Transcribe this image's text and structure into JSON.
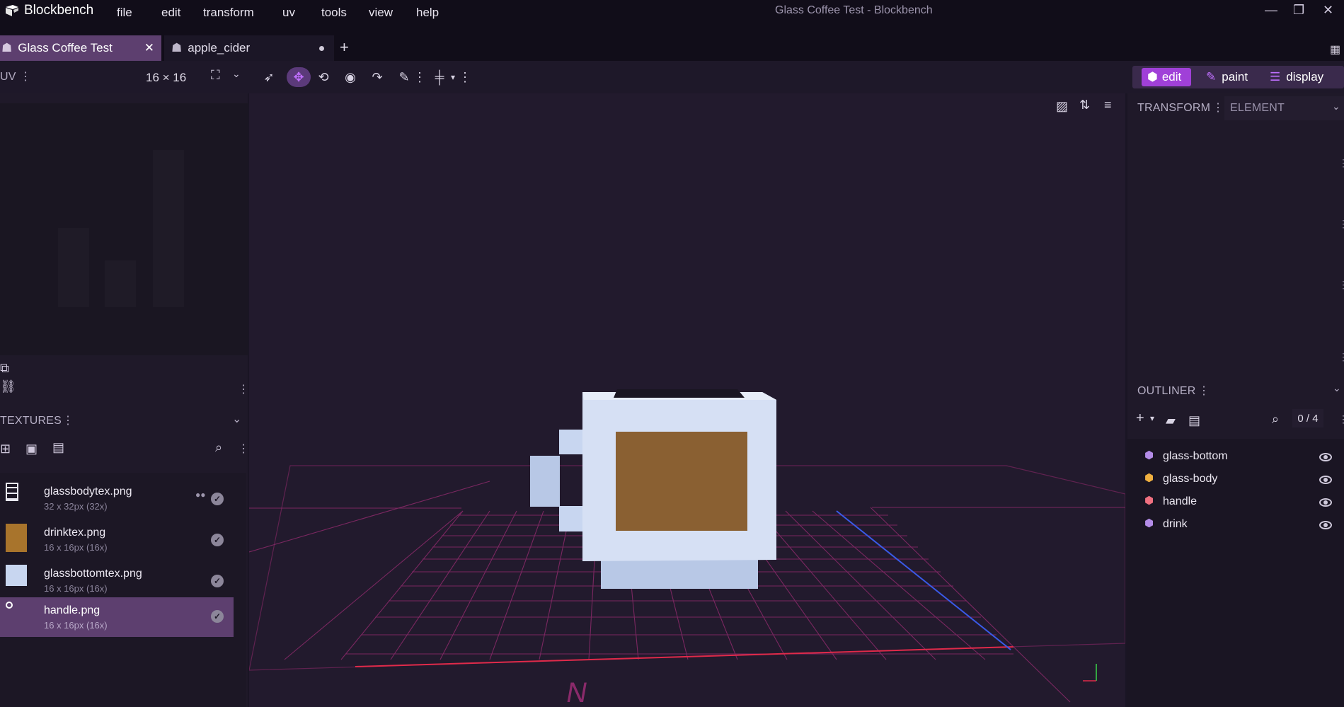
{
  "app": {
    "name": "Blockbench",
    "window_title": "Glass Coffee Test - Blockbench"
  },
  "menu": [
    "file",
    "edit",
    "transform",
    "uv",
    "tools",
    "view",
    "help"
  ],
  "tabs": [
    {
      "label": "Glass Coffee Test",
      "active": true
    },
    {
      "label": "apple_cider",
      "active": false
    }
  ],
  "uv_panel": {
    "title": "UV",
    "size": "16 × 16"
  },
  "textures": {
    "title": "TEXTURES",
    "items": [
      {
        "name": "glassbodytex.png",
        "size": "32 x 32px (32x)"
      },
      {
        "name": "drinktex.png",
        "size": "16 x 16px (16x)"
      },
      {
        "name": "glassbottomtex.png",
        "size": "16 x 16px (16x)"
      },
      {
        "name": "handle.png",
        "size": "16 x 16px (16x)",
        "selected": true
      }
    ]
  },
  "modes": {
    "edit": "edit",
    "paint": "paint",
    "display": "display"
  },
  "transform": {
    "title": "TRANSFORM",
    "dropdown": "ELEMENT"
  },
  "outliner": {
    "title": "OUTLINER",
    "count": "0 / 4",
    "items": [
      {
        "name": "glass-bottom",
        "color": "#b48ce8"
      },
      {
        "name": "glass-body",
        "color": "#f0b040"
      },
      {
        "name": "handle",
        "color": "#f07080"
      },
      {
        "name": "drink",
        "color": "#b48ce8"
      }
    ]
  },
  "colors": {
    "accent": "#a040d8",
    "selected_tab": "#5d3f6f",
    "grid": "#8a2a6a",
    "x_axis": "#e02a4a",
    "z_axis": "#3a5ae8"
  }
}
